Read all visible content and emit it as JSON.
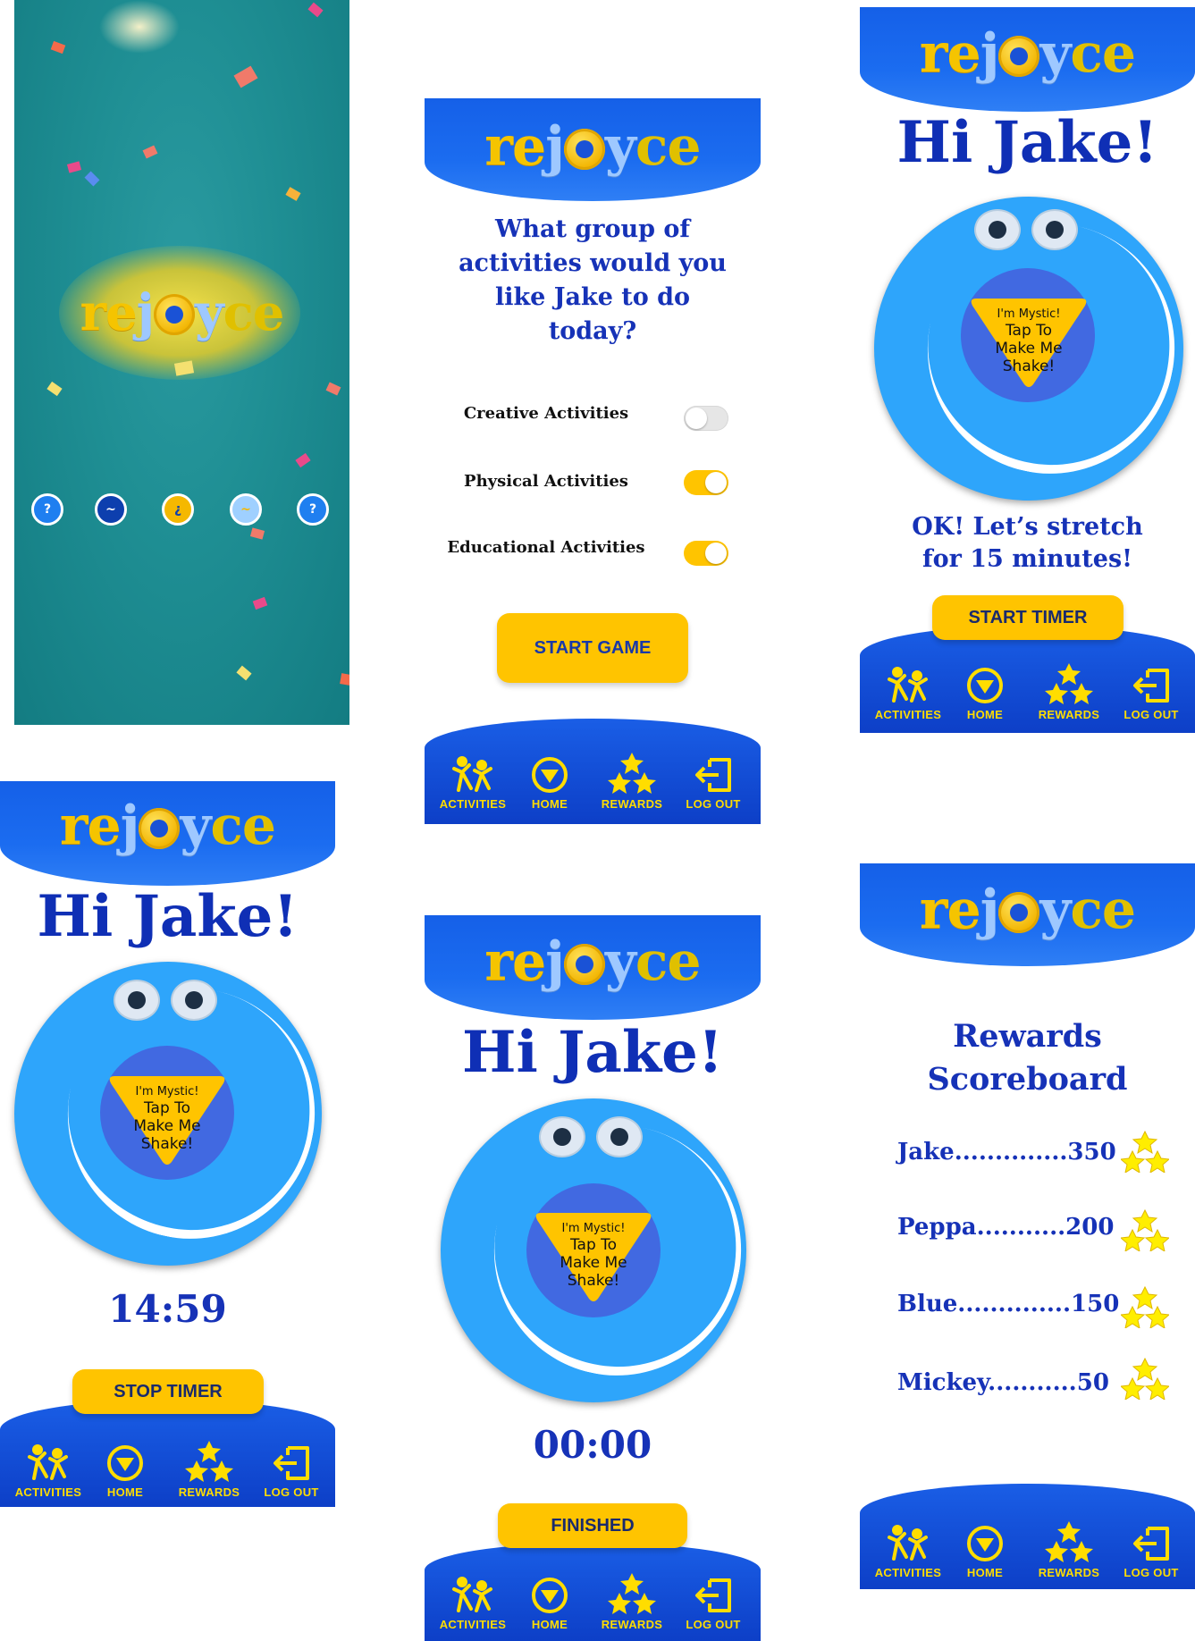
{
  "brand": {
    "logo_text": "rejoyce"
  },
  "colors": {
    "primary_blue": "#1b5fe6",
    "accent_yellow": "#ffc400",
    "blob_blue": "#2ea5fb",
    "text_blue": "#1632b7"
  },
  "splash": {
    "page_dots": [
      "?",
      "~",
      "¿",
      "~",
      "?"
    ]
  },
  "activity_select": {
    "question": [
      "What group of",
      "activities would you",
      "like Jake to do",
      "today?"
    ],
    "options": [
      {
        "label": "Creative Activities",
        "enabled": false
      },
      {
        "label": "Physical Activities",
        "enabled": true
      },
      {
        "label": "Educational Activities",
        "enabled": true
      }
    ],
    "start_label": "START GAME"
  },
  "character": {
    "badge_top": "I'm Mystic!",
    "badge_lines": [
      "Tap To",
      "Make Me",
      "Shake!"
    ]
  },
  "home_start": {
    "greeting": "Hi Jake!",
    "prompt": [
      "OK! Let’s stretch",
      "for 15 minutes!"
    ],
    "button_label": "START TIMER"
  },
  "home_running": {
    "greeting": "Hi Jake!",
    "timer": "14:59",
    "button_label": "STOP TIMER"
  },
  "home_finished": {
    "greeting": "Hi Jake!",
    "timer": "00:00",
    "button_label": "FINISHED"
  },
  "rewards": {
    "title": [
      "Rewards",
      "Scoreboard"
    ],
    "rows": [
      {
        "text": "Jake..............350"
      },
      {
        "text": "Peppa...........200"
      },
      {
        "text": "Blue..............150"
      },
      {
        "text": "Mickey...........50"
      }
    ]
  },
  "nav": [
    {
      "label": "ACTIVITIES",
      "icon": "activities-icon"
    },
    {
      "label": "HOME",
      "icon": "home-icon"
    },
    {
      "label": "REWARDS",
      "icon": "rewards-icon"
    },
    {
      "label": "LOG OUT",
      "icon": "logout-icon"
    }
  ]
}
